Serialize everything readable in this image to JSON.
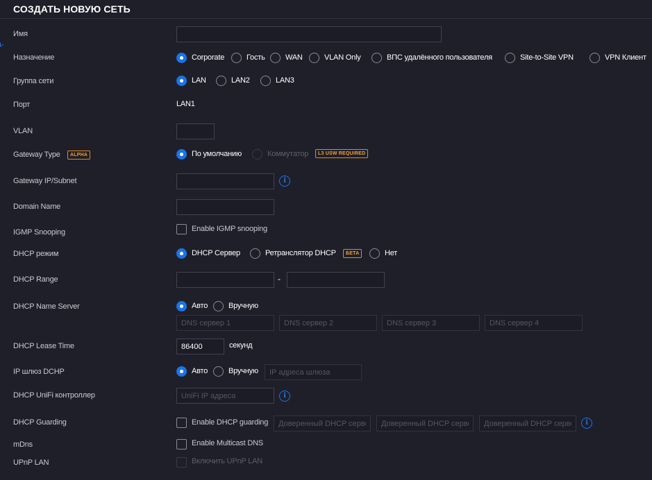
{
  "header": {
    "title": "СОЗДАТЬ НОВУЮ СЕТЬ"
  },
  "fields": {
    "name": {
      "label": "Имя",
      "value": ""
    },
    "purpose": {
      "label": "Назначение",
      "options": [
        "Corporate",
        "Гость",
        "WAN",
        "VLAN Only",
        "ВПС удалённого пользователя",
        "Site-to-Site VPN",
        "VPN Клиент"
      ],
      "selected": "Corporate"
    },
    "network_group": {
      "label": "Группа сети",
      "options": [
        "LAN",
        "LAN2",
        "LAN3"
      ],
      "selected": "LAN"
    },
    "port": {
      "label": "Порт",
      "value": "LAN1"
    },
    "vlan": {
      "label": "VLAN",
      "value": ""
    },
    "gateway_type": {
      "label": "Gateway Type",
      "badge": "ALPHA",
      "options": [
        "По умолчанию",
        "Коммутатор"
      ],
      "selected": "По умолчанию",
      "switch_badge": "L3 USW REQUIRED"
    },
    "gateway_subnet": {
      "label": "Gateway IP/Subnet",
      "value": "",
      "icon": "info-icon"
    },
    "domain_name": {
      "label": "Domain Name",
      "value": ""
    },
    "igmp": {
      "label": "IGMP Snooping",
      "checkbox_label": "Enable IGMP snooping",
      "checked": false
    },
    "dhcp_mode": {
      "label": "DHCP режим",
      "options": [
        "DHCP Сервер",
        "Ретранслятор DHCP",
        "Нет"
      ],
      "selected": "DHCP Сервер",
      "relay_badge": "БЕТА"
    },
    "dhcp_range": {
      "label": "DHCP Range",
      "start": "",
      "end": "",
      "separator": "-"
    },
    "dhcp_name_server": {
      "label": "DHCP Name Server",
      "options": [
        "Авто",
        "Вручную"
      ],
      "selected": "Авто",
      "placeholders": [
        "DNS сервер 1",
        "DNS сервер 2",
        "DNS сервер 3",
        "DNS сервер 4"
      ]
    },
    "dhcp_lease": {
      "label": "DHCP Lease Time",
      "value": "86400",
      "unit": "секунд"
    },
    "dhcp_gateway": {
      "label": "IP шлюз DCHP",
      "options": [
        "Авто",
        "Вручную"
      ],
      "selected": "Авто",
      "placeholder": "IP адреса шлюза"
    },
    "unifi_controller": {
      "label": "DHCP UniFi контроллер",
      "placeholder": "UniFi IP адреса",
      "icon": "info-icon"
    },
    "dhcp_guarding": {
      "label": "DHCP Guarding",
      "checkbox_label": "Enable DHCP guarding",
      "checked": false,
      "placeholders": [
        "Доверенный DHCP сервер",
        "Доверенный DHCP сервер",
        "Доверенный DHCP сервер"
      ],
      "icon": "info-icon"
    },
    "mdns": {
      "label": "mDns",
      "checkbox_label": "Enable Multicast DNS",
      "checked": false
    },
    "upnp": {
      "label": "UPnP LAN",
      "checkbox_label": "Включить UPnP LAN",
      "checked": false
    }
  },
  "colors": {
    "accent": "#1a74e8",
    "badge": "#f0a030",
    "background": "#1f1f2a"
  }
}
